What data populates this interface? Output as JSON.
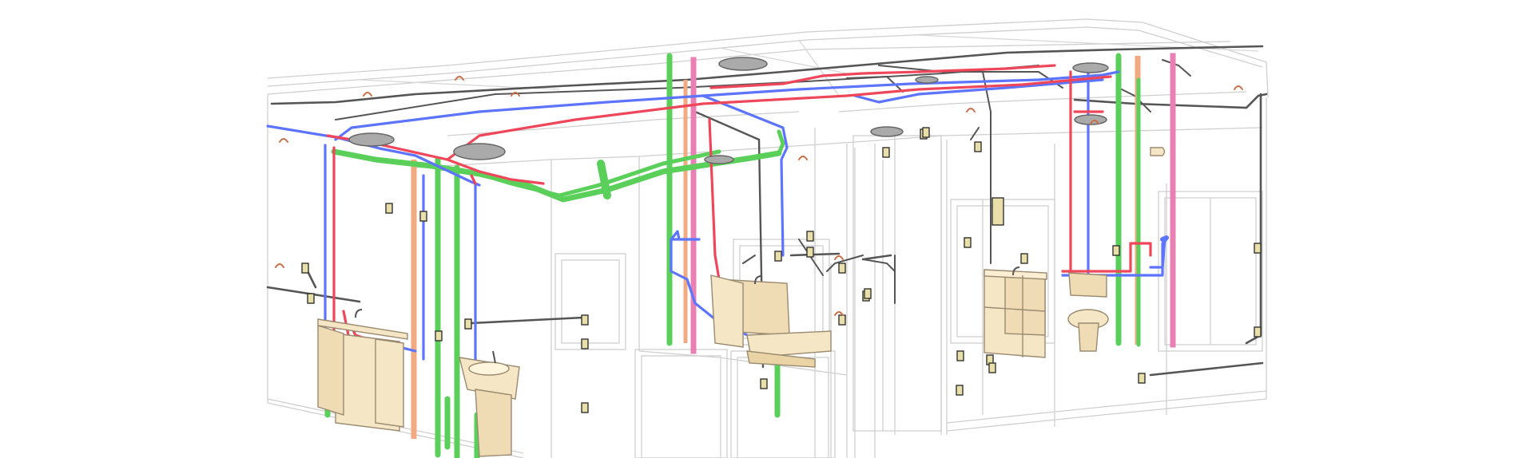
{
  "colors": {
    "background": "#ffffff",
    "architecture": "#c9c9c9",
    "architecture_dark": "#9a9a9a",
    "cold_water": "#5a74ff",
    "hot_water": "#f0465a",
    "waste": "#55d45a",
    "vent": "#e888b8",
    "hot_return": "#f4b088",
    "gas_duct": "#5a5a5a",
    "fixture_fill": "#f5e6c6",
    "fixture_stroke": "#9a8a70",
    "device_fill": "#e8e0a8"
  },
  "systems": [
    {
      "id": "cold-water",
      "icon": "cold-water-pipe"
    },
    {
      "id": "hot-water",
      "icon": "hot-water-pipe"
    },
    {
      "id": "sanitary-waste",
      "icon": "waste-pipe"
    },
    {
      "id": "vent",
      "icon": "vent-pipe"
    },
    {
      "id": "hot-water-return",
      "icon": "return-pipe"
    },
    {
      "id": "gas-conduit",
      "icon": "gas-pipe"
    }
  ],
  "fixtures": [
    {
      "id": "vanity-left",
      "icon": "vanity-cabinet-icon"
    },
    {
      "id": "sink-left",
      "icon": "pedestal-sink-icon"
    },
    {
      "id": "sink-center",
      "icon": "wall-sink-icon"
    },
    {
      "id": "vanity-right",
      "icon": "vanity-cabinet-icon"
    },
    {
      "id": "toilet-right",
      "icon": "toilet-icon"
    }
  ]
}
